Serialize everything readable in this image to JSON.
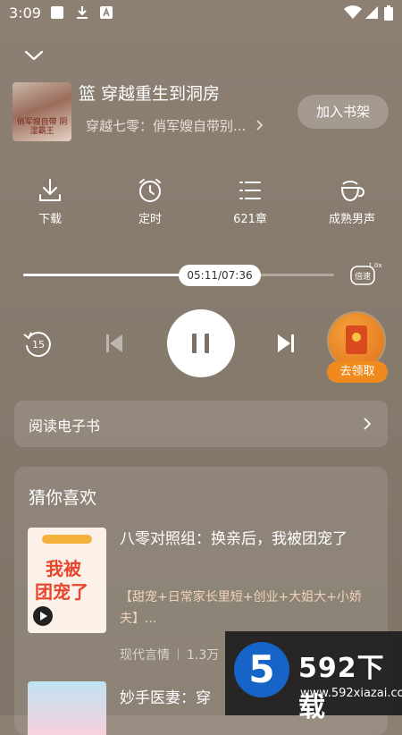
{
  "status_bar": {
    "time": "3:09"
  },
  "book": {
    "cover_text": "俏军嫂自带 阴湿霸王",
    "title": "篮 穿越重生到洞房",
    "subtitle": "穿越七零：俏军嫂自带别...",
    "add_to_shelf": "加入书架"
  },
  "actions": [
    {
      "label": "下载",
      "icon": "download-icon"
    },
    {
      "label": "定时",
      "icon": "alarm-clock-icon"
    },
    {
      "label": "621章",
      "icon": "chapter-list-icon"
    },
    {
      "label": "成熟男声",
      "icon": "voice-icon"
    }
  ],
  "progress": {
    "time_label": "05:11/07:36",
    "fraction": 0.682,
    "speed_label": "倍速",
    "speed_value": "1.0x"
  },
  "controls": {
    "rewind_label": "15"
  },
  "gift": {
    "label": "去领取"
  },
  "read_ebook": {
    "label": "阅读电子书"
  },
  "recommend": {
    "heading": "猜你喜欢",
    "books": [
      {
        "title": "八零对照组：换亲后，我被团宠了",
        "desc": "【甜宠+日常家长里短+创业+大姐大+小娇夫】...",
        "category": "现代言情",
        "count": "1.3万",
        "cover_line1": "我被",
        "cover_line2": "团宠了"
      },
      {
        "title": "妙手医妻：穿"
      }
    ]
  },
  "watermark": {
    "logo": "5",
    "name": "592下载",
    "url": "www.592xiazai.com"
  }
}
